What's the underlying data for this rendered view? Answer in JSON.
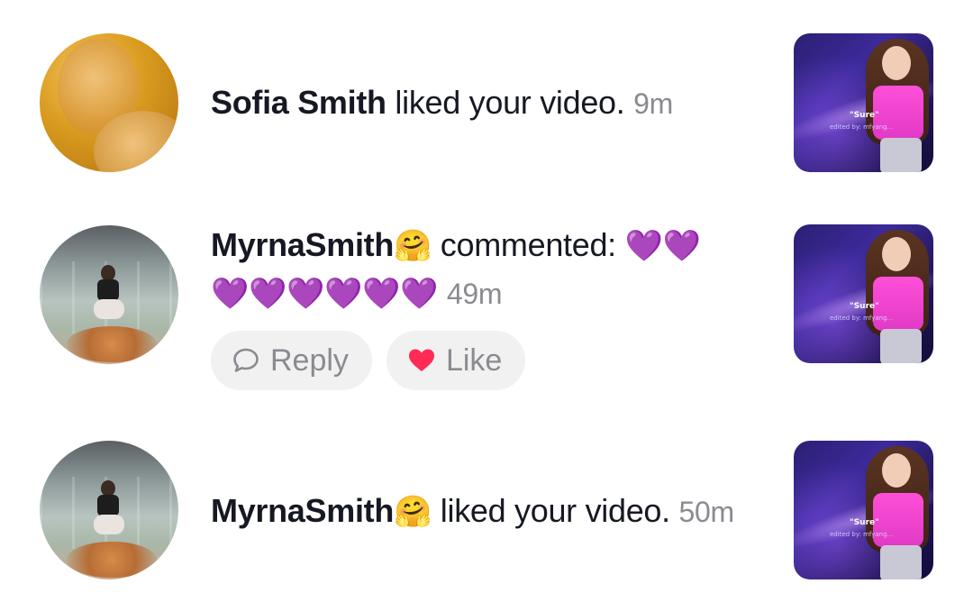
{
  "notifications": [
    {
      "avatar": "warm-portrait-avatar",
      "name": "Sofia Smith",
      "name_emoji": "",
      "action": "liked your video.",
      "time": "9m",
      "thumbnail": {
        "caption": "\"Sure\"",
        "credit": "edited by: mfyang..."
      }
    },
    {
      "avatar": "glass-floor-avatar",
      "name": "MyrnaSmith",
      "name_emoji": "🤗",
      "action": "commented:",
      "comment_line1": "💜💜",
      "comment_line2": "💜💜💜💜💜💜",
      "time": "49m",
      "reply_label": "Reply",
      "like_label": "Like",
      "thumbnail": {
        "caption": "\"Sure\"",
        "credit": "edited by: mfyang..."
      }
    },
    {
      "avatar": "glass-floor-avatar",
      "name": "MyrnaSmith",
      "name_emoji": "🤗",
      "action": "liked your video.",
      "time": "50m",
      "thumbnail": {
        "caption": "\"Sure\"",
        "credit": "edited by: mfyang..."
      }
    }
  ],
  "colors": {
    "reply_pill_bg": "#f1f1f2",
    "like_heart": "#fe2c55",
    "comment_heart": "#8e3fcf",
    "muted_text": "#8a8b91"
  }
}
